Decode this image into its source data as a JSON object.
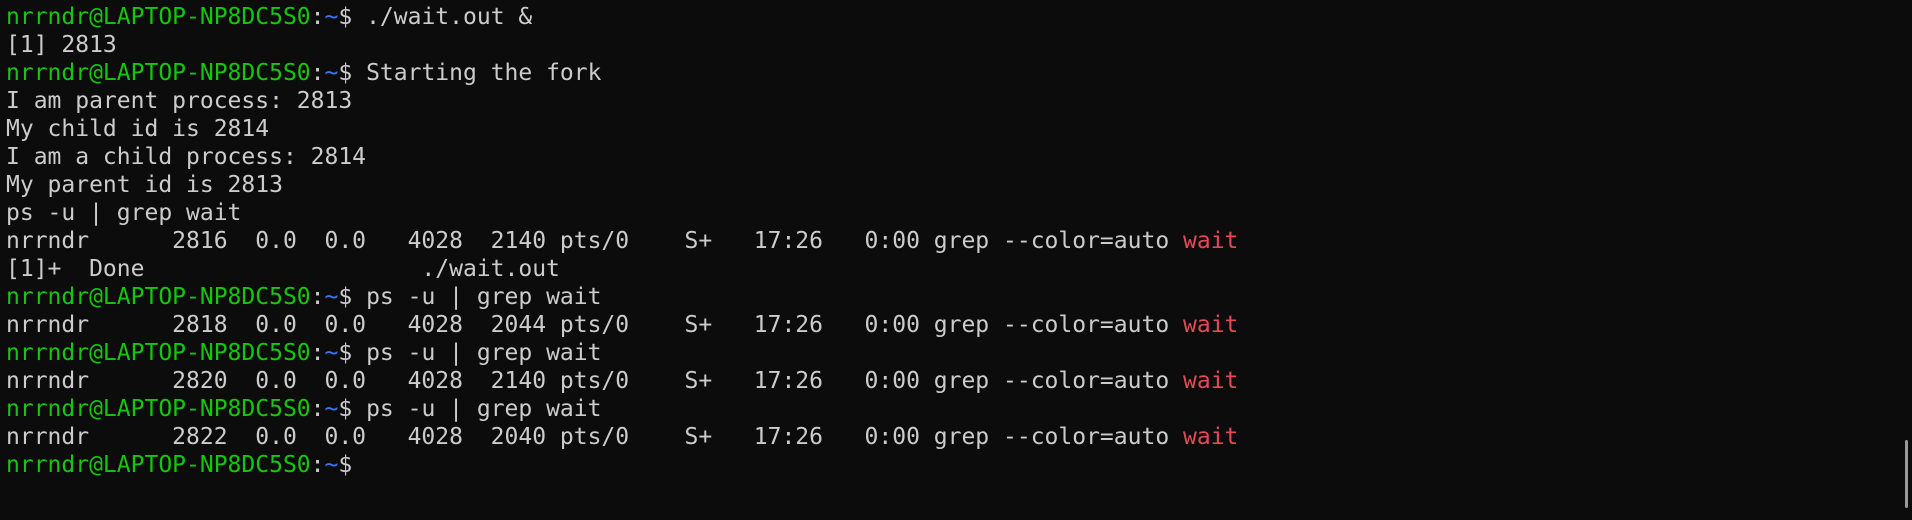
{
  "terminal": {
    "prompt": {
      "user_host": "nrrndr@LAPTOP-NP8DC5S0",
      "sep": ":",
      "path": "~",
      "symbol": "$"
    },
    "lines": [
      {
        "type": "prompt",
        "text": " ./wait.out &"
      },
      {
        "type": "output",
        "text": "[1] 2813"
      },
      {
        "type": "prompt",
        "text": " Starting the fork"
      },
      {
        "type": "output",
        "text": "I am parent process: 2813"
      },
      {
        "type": "output",
        "text": "My child id is 2814"
      },
      {
        "type": "output",
        "text": "I am a child process: 2814"
      },
      {
        "type": "output",
        "text": "My parent id is 2813"
      },
      {
        "type": "output",
        "text": "ps -u | grep wait"
      },
      {
        "type": "grep",
        "text": "nrrndr      2816  0.0  0.0   4028  2140 pts/0    S+   17:26   0:00 grep --color=auto ",
        "match": "wait"
      },
      {
        "type": "output",
        "text": "[1]+  Done                    ./wait.out"
      },
      {
        "type": "prompt",
        "text": " ps -u | grep wait"
      },
      {
        "type": "grep",
        "text": "nrrndr      2818  0.0  0.0   4028  2044 pts/0    S+   17:26   0:00 grep --color=auto ",
        "match": "wait"
      },
      {
        "type": "prompt",
        "text": " ps -u | grep wait"
      },
      {
        "type": "grep",
        "text": "nrrndr      2820  0.0  0.0   4028  2140 pts/0    S+   17:26   0:00 grep --color=auto ",
        "match": "wait"
      },
      {
        "type": "prompt",
        "text": " ps -u | grep wait"
      },
      {
        "type": "grep",
        "text": "nrrndr      2822  0.0  0.0   4028  2040 pts/0    S+   17:26   0:00 grep --color=auto ",
        "match": "wait"
      },
      {
        "type": "prompt",
        "text": ""
      }
    ]
  },
  "colors": {
    "background": "#0c0c0c",
    "foreground": "#cccccc",
    "prompt_user": "#16c60c",
    "prompt_path": "#3b78ff",
    "grep_match": "#e74856"
  }
}
